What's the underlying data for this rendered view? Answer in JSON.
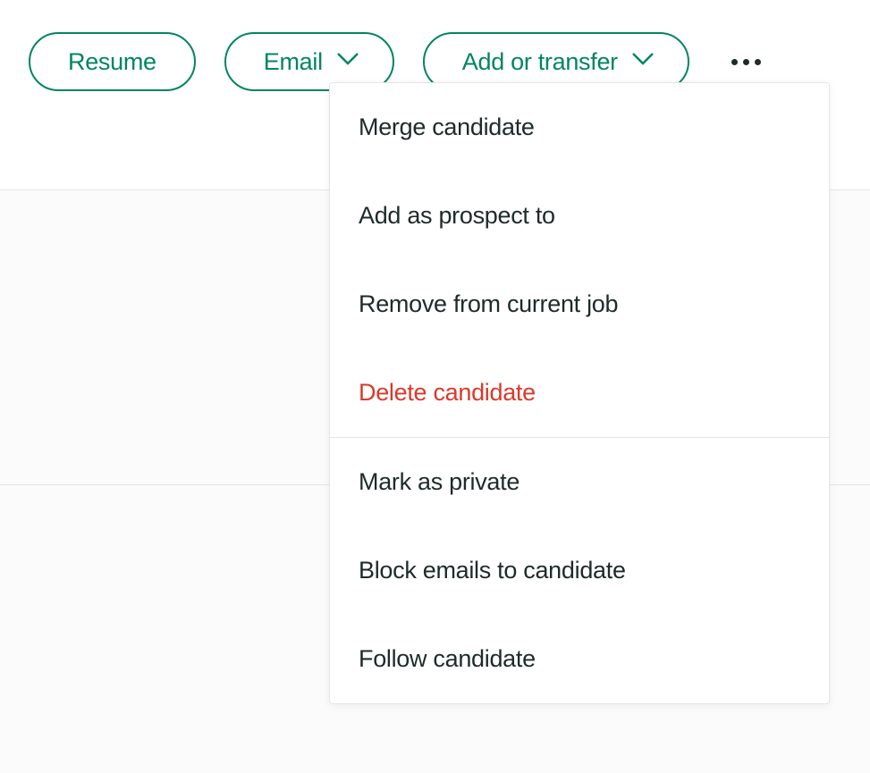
{
  "toolbar": {
    "resume_label": "Resume",
    "email_label": "Email",
    "add_transfer_label": "Add or transfer"
  },
  "menu": {
    "merge_label": "Merge candidate",
    "add_prospect_label": "Add as prospect to",
    "remove_job_label": "Remove from current job",
    "delete_label": "Delete candidate",
    "mark_private_label": "Mark as private",
    "block_emails_label": "Block emails to candidate",
    "follow_label": "Follow candidate"
  }
}
